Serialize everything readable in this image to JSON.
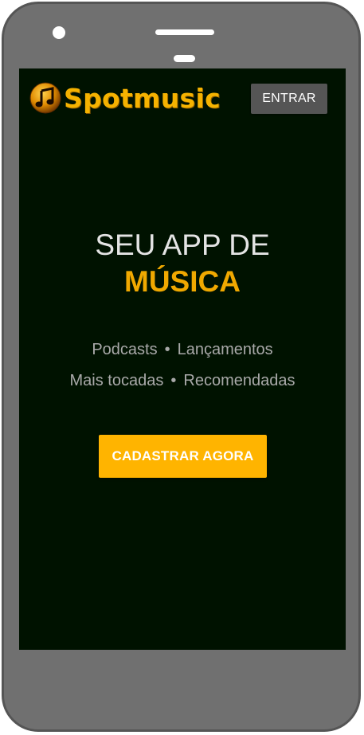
{
  "device": {
    "frame_color": "#707070",
    "screen_color": "#001200"
  },
  "header": {
    "logo_text": "Spotmusic",
    "logo_icon": "music-note-icon",
    "login_label": "ENTRAR"
  },
  "hero": {
    "line1": "SEU APP DE",
    "line2": "MÚSICA"
  },
  "features": {
    "row1": [
      "Podcasts",
      "Lançamentos"
    ],
    "row2": [
      "Mais tocadas",
      "Recomendadas"
    ],
    "separator": "•"
  },
  "cta": {
    "label": "CADASTRAR AGORA"
  },
  "colors": {
    "accent": "#ffb400",
    "hero_highlight": "#f0a800",
    "button_dark": "#555555"
  }
}
